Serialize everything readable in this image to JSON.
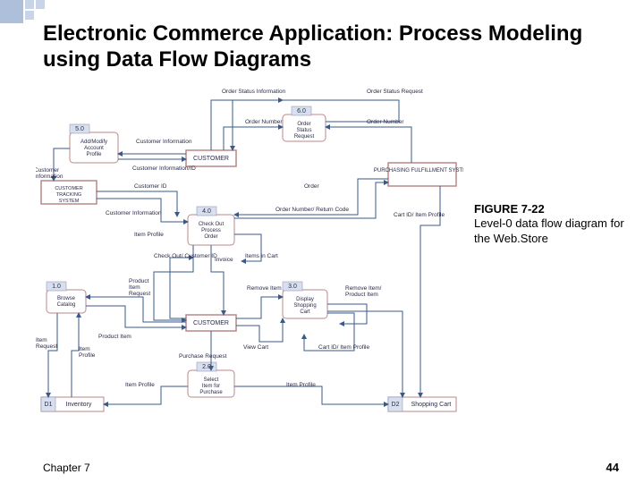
{
  "slide": {
    "title": "Electronic Commerce Application: Process Modeling using Data Flow Diagrams",
    "chapter": "Chapter 7",
    "page": "44"
  },
  "caption": {
    "heading": "FIGURE 7-22",
    "text": "Level-0 data flow diagram for the Web.Store"
  },
  "diagram": {
    "processes": {
      "p1": {
        "id": "1.0",
        "label": "Browse Catalog"
      },
      "p2": {
        "id": "2.0",
        "label": "Select Item for Purchase"
      },
      "p3": {
        "id": "3.0",
        "label": "Display Shopping Cart"
      },
      "p4": {
        "id": "4.0",
        "label": "Check Out Process Order"
      },
      "p5": {
        "id": "5.0",
        "label": "Add/Modify Account Profile"
      },
      "p6": {
        "id": "6.0",
        "label": "Order Status Request"
      }
    },
    "entities": {
      "customer_top": "CUSTOMER",
      "customer_mid": "CUSTOMER",
      "pfs": "PURCHASING FULFILLMENT SYSTEM",
      "cts": "CUSTOMER TRACKING SYSTEM"
    },
    "datastores": {
      "d1": {
        "id": "D1",
        "label": "Inventory"
      },
      "d2": {
        "id": "D2",
        "label": "Shopping Cart"
      }
    },
    "flows": {
      "order_status_info": "Order Status Information",
      "order_status_request": "Order Status Request",
      "order_number_l": "Order Number",
      "order_number_r": "Order Number",
      "customer_info": "Customer Information",
      "customer_info_id": "Customer Information/ID",
      "customer_id": "Customer ID",
      "order": "Order",
      "customer_info2": "Customer Information",
      "order_num_return": "Order Number/ Return Code",
      "cart_id_item": "Cart ID/ Item Profile",
      "item_profile_l": "Item Profile",
      "checkout_cid": "Check Out/ Customer ID",
      "invoice": "Invoice",
      "items_in_cart": "Items in Cart",
      "product_item_req": "Product Item Request",
      "remove_item": "Remove Item",
      "remove_item_pl": "Remove Item/ Product Item",
      "item_request": "Item Request",
      "product_item": "Product Item",
      "view_cart": "View Cart",
      "cart_id_item2": "Cart ID/ Item Profile",
      "purchase_request": "Purchase Request",
      "item_profile_b": "Item Profile",
      "item_profile_br": "Item Profile"
    }
  }
}
